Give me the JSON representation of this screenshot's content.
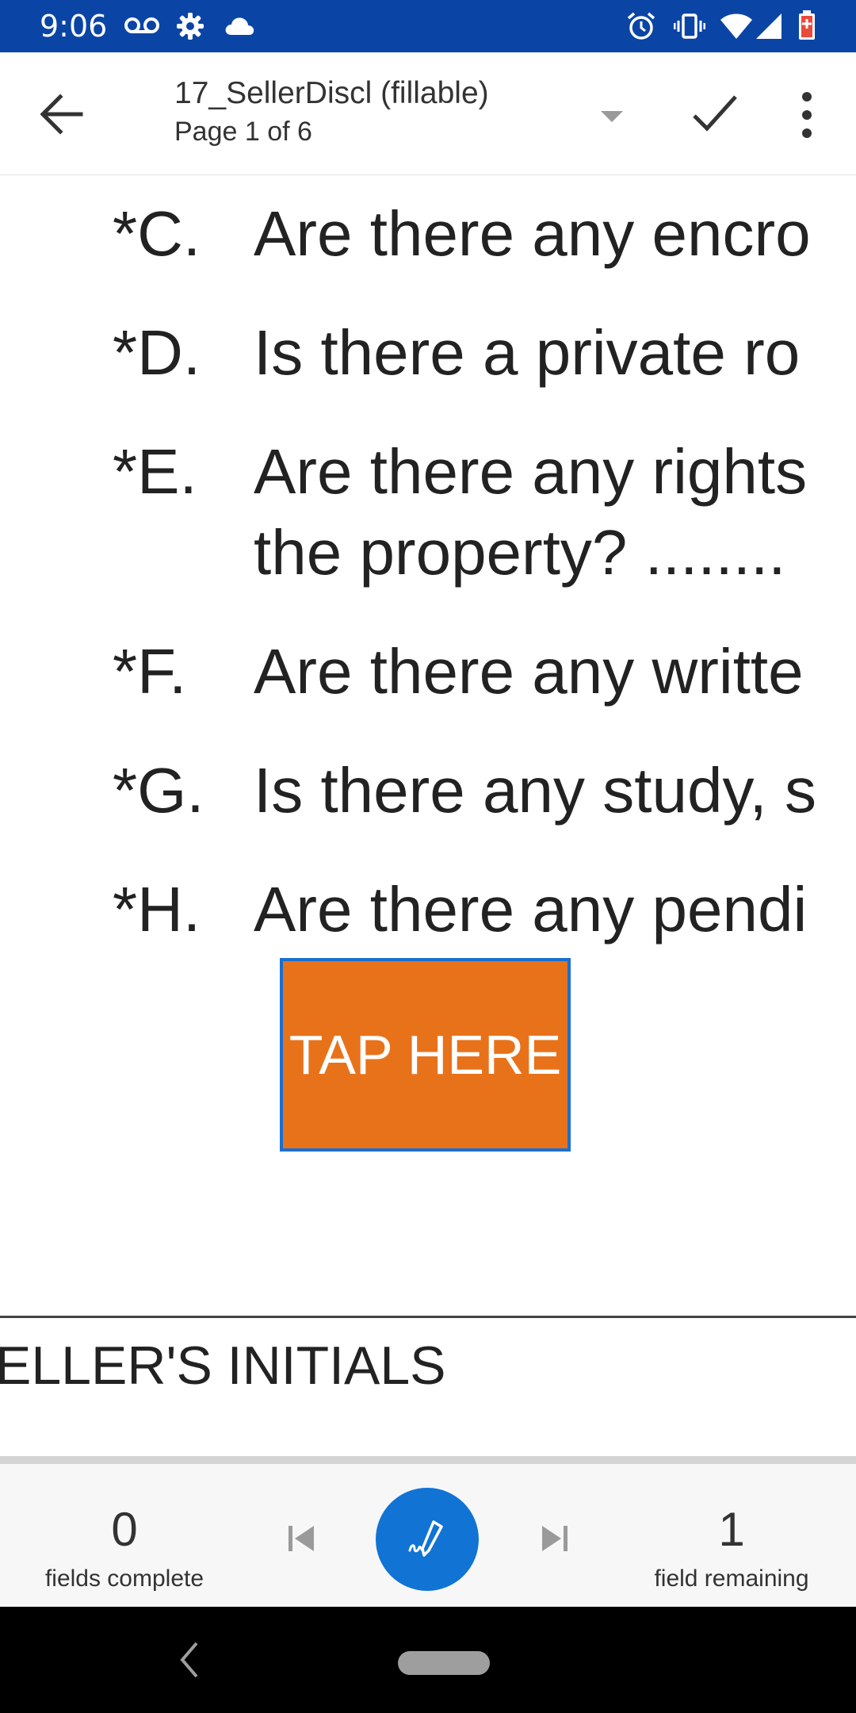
{
  "status_bar": {
    "time": "9:06",
    "left_icons": [
      "voicemail-icon",
      "settings-icon",
      "cloud-icon"
    ],
    "right_icons": [
      "alarm-icon",
      "vibrate-icon",
      "wifi-icon",
      "signal-icon",
      "battery-icon"
    ],
    "background": "#0a45a6"
  },
  "toolbar": {
    "title": "17_SellerDiscl (fillable)",
    "subtitle": "Page 1 of 6"
  },
  "document": {
    "questions": [
      {
        "letter": "*C.",
        "lines": [
          "Are there any encro"
        ]
      },
      {
        "letter": "*D.",
        "lines": [
          "Is there a private ro"
        ]
      },
      {
        "letter": "*E.",
        "lines": [
          "Are there any rights",
          "the property?  ........"
        ]
      },
      {
        "letter": "*F.",
        "lines": [
          "Are there any writte"
        ]
      },
      {
        "letter": "*G.",
        "lines": [
          "Is there any study, s"
        ]
      },
      {
        "letter": "*H.",
        "lines": [
          "Are there any pendi"
        ]
      }
    ],
    "tap_here_label": "TAP HERE",
    "initials_label": "ELLER'S INITIALS",
    "tap_here_color": "#e8721a",
    "tap_here_border": "#1a6fd1"
  },
  "bottom_bar": {
    "complete_count": "0",
    "complete_label": "fields complete",
    "remaining_count": "1",
    "remaining_label": "field remaining",
    "sign_button_color": "#1173d4"
  }
}
